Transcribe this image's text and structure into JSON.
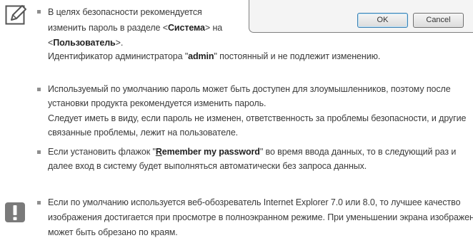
{
  "dialog": {
    "ok_label": "OK",
    "cancel_label": "Cancel"
  },
  "note_section": {
    "icon": "note-pencil-icon",
    "items": [
      {
        "lines": [
          {
            "t1": "В целях безопасности рекомендуется"
          },
          {
            "t1": "изменить пароль в разделе <",
            "b1": "Система",
            "t2": "> на"
          },
          {
            "t1": "<",
            "b1": "Пользователь",
            "t2": ">."
          },
          {
            "t1": "Идентификатор администратора \"",
            "b1": "admin",
            "t2": "\" постоянный и не подлежит изменению."
          }
        ]
      },
      {
        "lines": [
          {
            "t1": "Используемый по умолчанию пароль может быть доступен для злоумышленников, поэтому после"
          },
          {
            "t1": "установки продукта рекомендуется изменить пароль."
          },
          {
            "t1": "Следует иметь в виду, если пароль не изменен, ответственность за проблемы безопасности, и другие"
          },
          {
            "t1": "связанные проблемы, лежит на пользователе."
          }
        ]
      },
      {
        "lines": [
          {
            "t1": "Если установить флажок \"",
            "u1": "R",
            "b1": "emember my password",
            "t2": "\" во время ввода данных, то в следующий раз и"
          },
          {
            "t1": "далее вход в систему будет выполняться автоматически без запроса данных."
          }
        ]
      }
    ]
  },
  "warning_section": {
    "icon": "exclamation-icon",
    "items": [
      {
        "lines": [
          {
            "t1": "Если по умолчанию используется веб-обозреватель Internet Explorer 7.0 или 8.0, то лучшее качество"
          },
          {
            "t1": "изображения достигается при просмотре в полноэкранном режиме. При уменьшении экрана изображение"
          },
          {
            "t1": "может быть обрезано по краям."
          }
        ]
      }
    ]
  }
}
